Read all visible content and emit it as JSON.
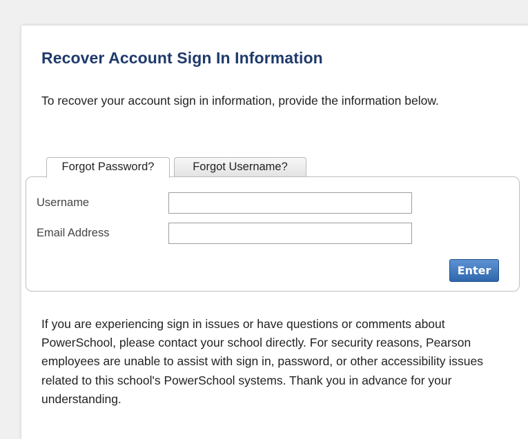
{
  "page": {
    "title": "Recover Account Sign In Information",
    "intro": "To recover your account sign in information, provide the information below."
  },
  "tabs": [
    {
      "label": "Forgot Password?",
      "active": true
    },
    {
      "label": "Forgot Username?",
      "active": false
    }
  ],
  "form": {
    "username_label": "Username",
    "username_value": "",
    "email_label": "Email Address",
    "email_value": "",
    "submit_label": "Enter"
  },
  "help_text": "If you are experiencing sign in issues or have questions or comments about PowerSchool, please contact your school directly. For security reasons, Pearson employees are unable to assist with sign in, password, or other accessibility issues related to this school's PowerSchool systems. Thank you in advance for your understanding.",
  "colors": {
    "title": "#1f3a6b",
    "button": "#3a72b8",
    "page_background": "#f0f0f0"
  }
}
